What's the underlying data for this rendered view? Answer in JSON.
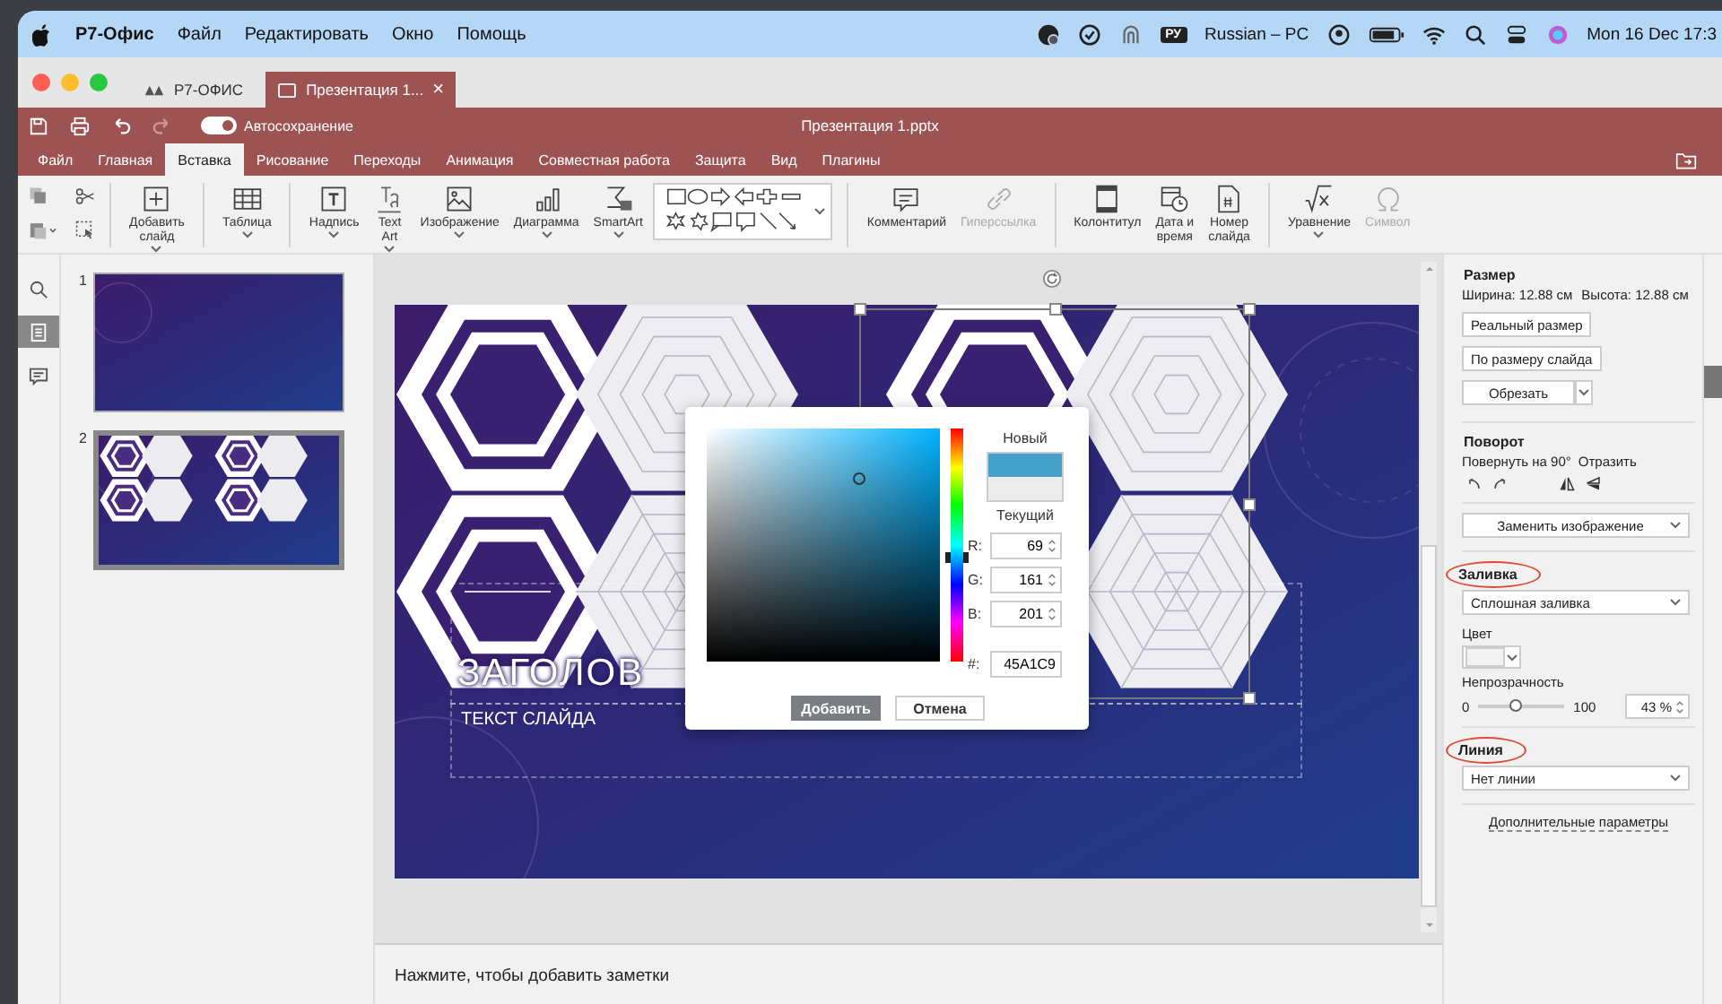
{
  "menubar": {
    "app": "Р7-Офис",
    "menus": [
      "Файл",
      "Редактировать",
      "Окно",
      "Помощь"
    ],
    "input_badge": "РУ",
    "keyboard": "Russian – PC",
    "clock": "Mon 16 Dec 17:3"
  },
  "tabs": [
    {
      "label": "Р7-ОФИС",
      "selected": false
    },
    {
      "label": "Презентация 1...",
      "selected": true,
      "close": "×"
    }
  ],
  "titlebar": {
    "autosave": {
      "label": "Автосохранение",
      "on": true
    },
    "document": "Презентация 1.pptx"
  },
  "menu_tabs": [
    {
      "label": "Файл",
      "selected": false
    },
    {
      "label": "Главная",
      "selected": false
    },
    {
      "label": "Вставка",
      "selected": true
    },
    {
      "label": "Рисование",
      "selected": false
    },
    {
      "label": "Переходы",
      "selected": false
    },
    {
      "label": "Анимация",
      "selected": false
    },
    {
      "label": "Совместная работа",
      "selected": false
    },
    {
      "label": "Защита",
      "selected": false
    },
    {
      "label": "Вид",
      "selected": false
    },
    {
      "label": "Плагины",
      "selected": false
    }
  ],
  "ribbon": {
    "groups": [
      {
        "items": [
          {
            "kind": "button",
            "lines": [
              "Добавить",
              "слайд"
            ],
            "dropdown": true,
            "disabled": false
          }
        ]
      },
      {
        "items": [
          {
            "kind": "button",
            "lines": [
              "Таблица"
            ],
            "dropdown": true,
            "disabled": false
          }
        ]
      },
      {
        "items": [
          {
            "kind": "button",
            "lines": [
              "Надпись"
            ],
            "dropdown": true,
            "disabled": false
          },
          {
            "kind": "button",
            "lines": [
              "Text",
              "Art"
            ],
            "dropdown": true,
            "disabled": false
          },
          {
            "kind": "button",
            "lines": [
              "Изображение"
            ],
            "dropdown": true,
            "disabled": false
          },
          {
            "kind": "button",
            "lines": [
              "Диаграмма"
            ],
            "dropdown": true,
            "disabled": false
          },
          {
            "kind": "button",
            "lines": [
              "SmartArt"
            ],
            "dropdown": true,
            "disabled": false
          },
          {
            "kind": "gallery"
          }
        ]
      },
      {
        "items": [
          {
            "kind": "button",
            "lines": [
              "Комментарий"
            ],
            "dropdown": false,
            "disabled": false
          },
          {
            "kind": "button",
            "lines": [
              "Гиперссылка"
            ],
            "dropdown": false,
            "disabled": true
          }
        ]
      },
      {
        "items": [
          {
            "kind": "button",
            "lines": [
              "Колонтитул"
            ],
            "dropdown": false,
            "disabled": false
          },
          {
            "kind": "button",
            "lines": [
              "Дата и",
              "время"
            ],
            "dropdown": false,
            "disabled": false
          },
          {
            "kind": "button",
            "lines": [
              "Номер",
              "слайда"
            ],
            "dropdown": false,
            "disabled": false
          }
        ]
      },
      {
        "items": [
          {
            "kind": "button",
            "lines": [
              "Уравнение"
            ],
            "dropdown": true,
            "disabled": false
          },
          {
            "kind": "button",
            "lines": [
              "Символ"
            ],
            "dropdown": false,
            "disabled": true
          }
        ]
      }
    ]
  },
  "left_strip": [
    {
      "selected": false
    },
    {
      "selected": true
    },
    {
      "selected": false
    }
  ],
  "slides": [
    {
      "number": "1",
      "selected": false,
      "kind": "blank"
    },
    {
      "number": "2",
      "selected": true,
      "kind": "hexagons"
    }
  ],
  "slide": {
    "title": "ЗАГОЛОВ",
    "text": "ТЕКСТ СЛАЙДА"
  },
  "color_dialog": {
    "new_label": "Новый",
    "current_label": "Текущий",
    "channels": [
      {
        "label": "R:",
        "value": "69"
      },
      {
        "label": "G:",
        "value": "161"
      },
      {
        "label": "B:",
        "value": "201"
      }
    ],
    "hex_label": "#:",
    "hex": "45A1C9",
    "add": "Добавить",
    "cancel": "Отмена"
  },
  "notes": {
    "placeholder": "Нажмите, чтобы добавить заметки"
  },
  "panel": {
    "size": {
      "heading": "Размер",
      "width": "Ширина: 12.88 см",
      "height": "Высота: 12.88 см",
      "actual": "Реальный размер",
      "fit": "По размеру слайда",
      "crop": "Обрезать"
    },
    "rotation": {
      "heading": "Поворот",
      "rotate": "Повернуть на 90°",
      "flip": "Отразить"
    },
    "replace": "Заменить изображение",
    "fill": {
      "heading": "Заливка",
      "highlighted": true,
      "type": "Сплошная заливка",
      "color_label": "Цвет",
      "color": "#f2f2f2",
      "opacity_label": "Непрозрачность",
      "min": "0",
      "max": "100",
      "level": 0.43,
      "value": "43 %"
    },
    "line": {
      "heading": "Линия",
      "highlighted": true,
      "type": "Нет линии"
    },
    "more": "Дополнительные параметры"
  }
}
